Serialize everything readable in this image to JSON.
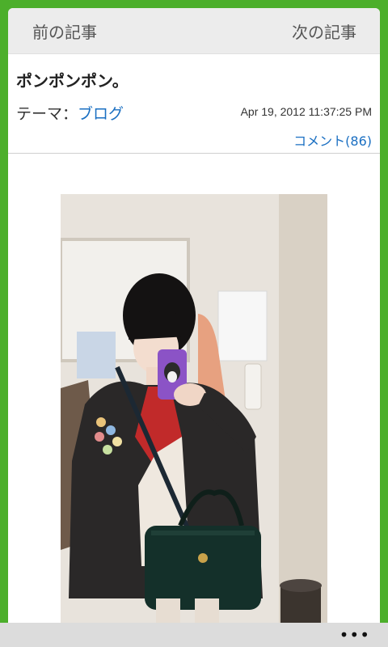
{
  "nav": {
    "prev_label": "前の記事",
    "next_label": "次の記事"
  },
  "post": {
    "title": "ポンポンポン。",
    "theme_prefix": "テーマ：",
    "theme_name": "ブログ",
    "timestamp": "Apr 19, 2012 11:37:25 PM",
    "comments_label": "コメント(86)"
  },
  "photo": {
    "icon": "photo-image"
  },
  "bottom_bar": {
    "more_label": "•••"
  },
  "colors": {
    "frame_background": "#4caf2b",
    "link": "#1a6fc2"
  }
}
